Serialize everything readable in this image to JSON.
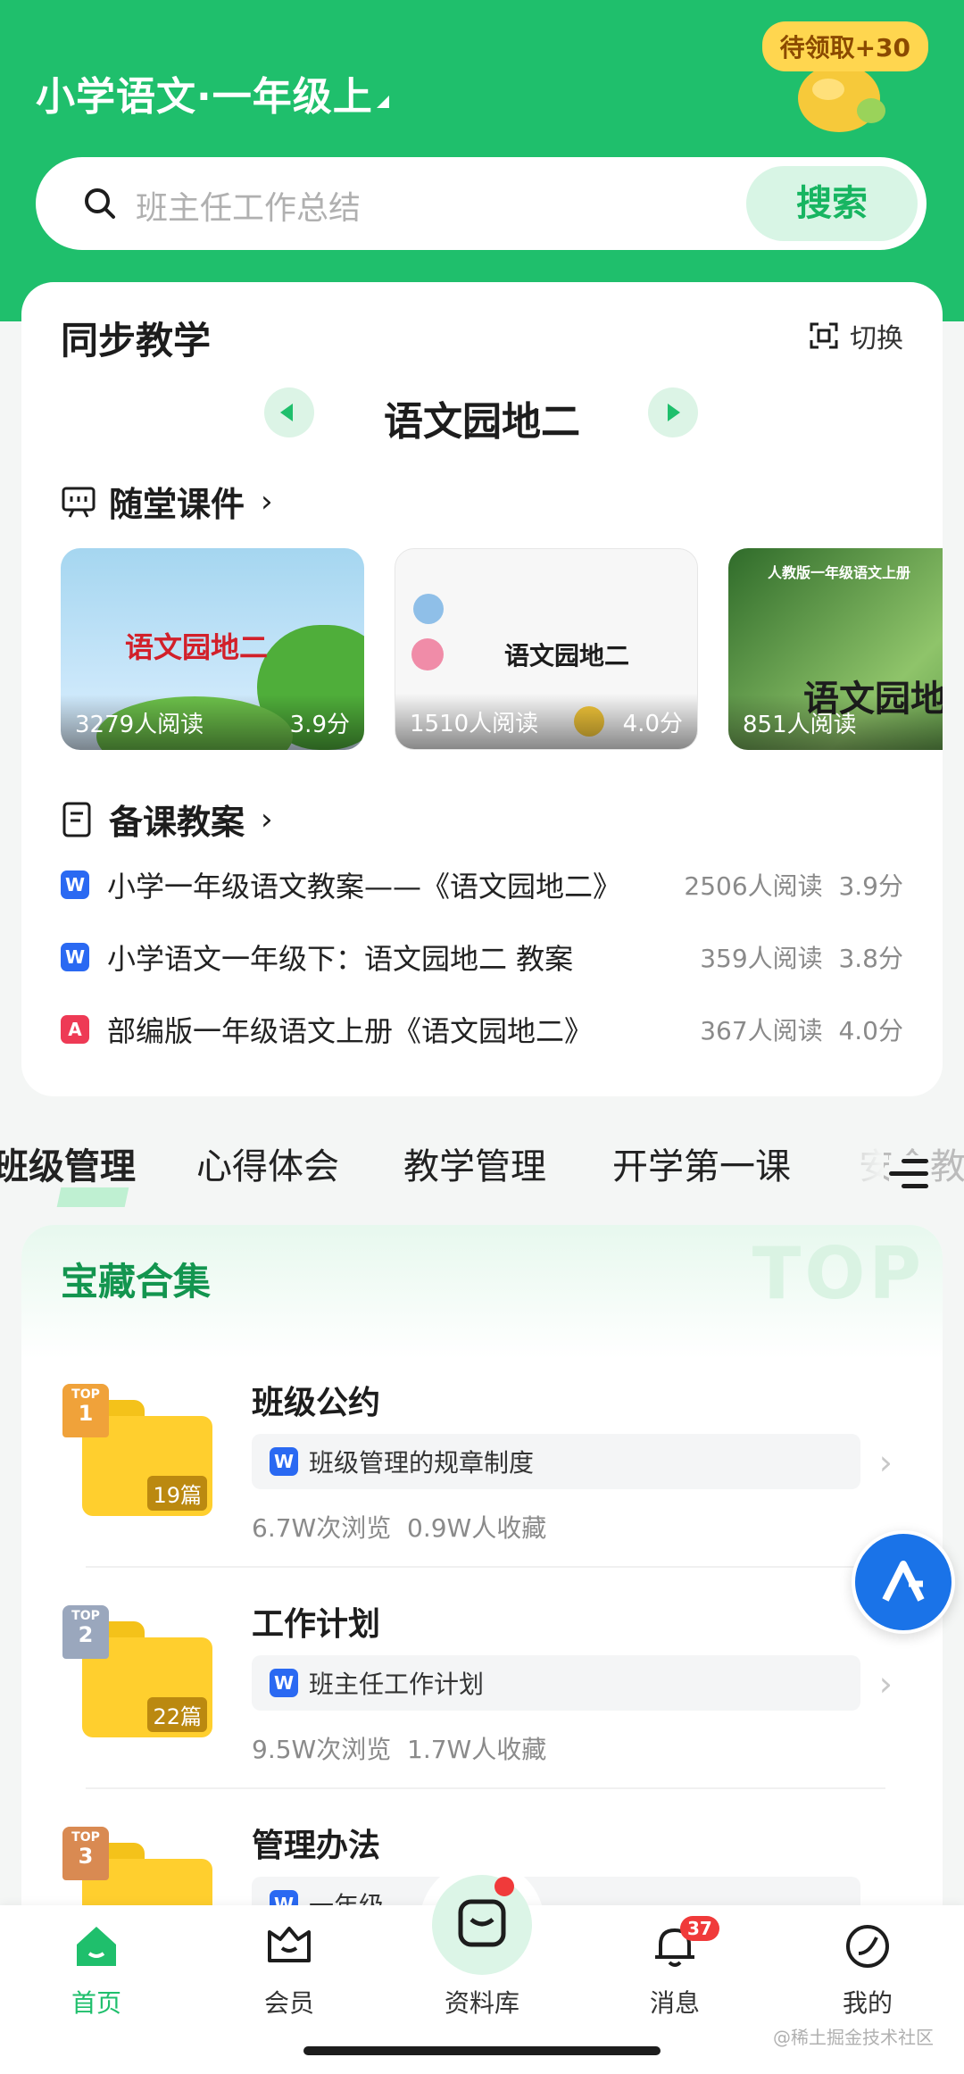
{
  "header": {
    "grade_title": "小学语文·一年级上",
    "reward_badge": "待领取+30"
  },
  "search": {
    "placeholder": "班主任工作总结",
    "button_label": "搜索"
  },
  "sync": {
    "title": "同步教学",
    "switch_label": "切换",
    "unit_name": "语文园地二",
    "courseware_title": "随堂课件",
    "courseware": [
      {
        "art_text": "语文园地二",
        "reads": "3279人阅读",
        "score": "3.9分"
      },
      {
        "art_text": "语文园地二",
        "reads": "1510人阅读",
        "score": "4.0分"
      },
      {
        "art_top": "人教版一年级语文上册",
        "art_text": "语文园地",
        "reads": "851人阅读",
        "score": ""
      }
    ],
    "plans_title": "备课教案",
    "plans": [
      {
        "type": "word",
        "icon": "W",
        "title": "小学一年级语文教案——《语文园地二》",
        "reads": "2506人阅读",
        "score": "3.9分"
      },
      {
        "type": "word",
        "icon": "W",
        "title": "小学语文一年级下：语文园地二 教案",
        "reads": "359人阅读",
        "score": "3.8分"
      },
      {
        "type": "pdf",
        "icon": "A",
        "title": "部编版一年级语文上册《语文园地二》",
        "reads": "367人阅读",
        "score": "4.0分"
      }
    ]
  },
  "categories": [
    "班级管理",
    "心得体会",
    "教学管理",
    "开学第一课",
    "安全教育"
  ],
  "treasure": {
    "title": "宝藏合集",
    "bg_word": "TOP",
    "collections": [
      {
        "rank_label": "TOP",
        "rank": "1",
        "name": "班级公约",
        "count": "19篇",
        "doc_icon": "W",
        "doc": "班级管理的规章制度",
        "views": "6.7W次浏览",
        "favs": "0.9W人收藏",
        "rank_color": "#f0a23a"
      },
      {
        "rank_label": "TOP",
        "rank": "2",
        "name": "工作计划",
        "count": "22篇",
        "doc_icon": "W",
        "doc": "班主任工作计划",
        "views": "9.5W次浏览",
        "favs": "1.7W人收藏",
        "rank_color": "#9aa7bd"
      },
      {
        "rank_label": "TOP",
        "rank": "3",
        "name": "管理办法",
        "count": "",
        "doc_icon": "W",
        "doc": "一年级",
        "views": "",
        "favs": "",
        "rank_color": "#d98a52"
      }
    ]
  },
  "tabbar": {
    "items": [
      "首页",
      "会员",
      "资料库",
      "消息",
      "我的"
    ],
    "message_badge": "37"
  },
  "watermark": "@稀土掘金技术社区",
  "colors": {
    "brand": "#1fbf6c",
    "word_blue": "#2a69f2",
    "pdf_red": "#ee3a55"
  }
}
